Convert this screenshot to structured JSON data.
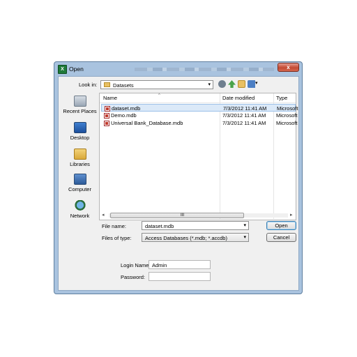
{
  "window": {
    "title": "Open",
    "close_glyph": "x",
    "app_icon_letter": "X"
  },
  "toolbar": {
    "look_in_label": "Look in:",
    "look_in_value": "Datasets",
    "icons": [
      "back-icon",
      "up-folder-icon",
      "new-folder-icon",
      "views-menu-icon"
    ]
  },
  "places": [
    {
      "label": "Recent Places",
      "icon": "recent-places-icon"
    },
    {
      "label": "Desktop",
      "icon": "desktop-icon"
    },
    {
      "label": "Libraries",
      "icon": "libraries-icon"
    },
    {
      "label": "Computer",
      "icon": "computer-icon"
    },
    {
      "label": "Network",
      "icon": "network-icon"
    }
  ],
  "file_list": {
    "columns": [
      "Name",
      "Date modified",
      "Type"
    ],
    "rows": [
      {
        "name": "dataset.mdb",
        "date": "7/3/2012 11:41 AM",
        "type": "Microsoft",
        "selected": true
      },
      {
        "name": "Demo.mdb",
        "date": "7/3/2012 11:41 AM",
        "type": "Microsoft",
        "selected": false
      },
      {
        "name": "Universal Bank_Database.mdb",
        "date": "7/3/2012 11:41 AM",
        "type": "Microsoft",
        "selected": false
      }
    ],
    "scroll_grip": "III"
  },
  "file_name": {
    "label": "File name:",
    "value": "dataset.mdb"
  },
  "files_of_type": {
    "label": "Files of type:",
    "value": "Access Databases (*.mdb; *.accdb)"
  },
  "buttons": {
    "open": "Open",
    "cancel": "Cancel"
  },
  "login": {
    "name_label": "Login Name:",
    "name_value": "Admin",
    "password_label": "Password:",
    "password_value": ""
  },
  "colors": {
    "title_bar": "#a9c3df",
    "close_button": "#c44a32",
    "selection": "#dbe9f8",
    "dialog_bg": "#f0f0f0"
  }
}
